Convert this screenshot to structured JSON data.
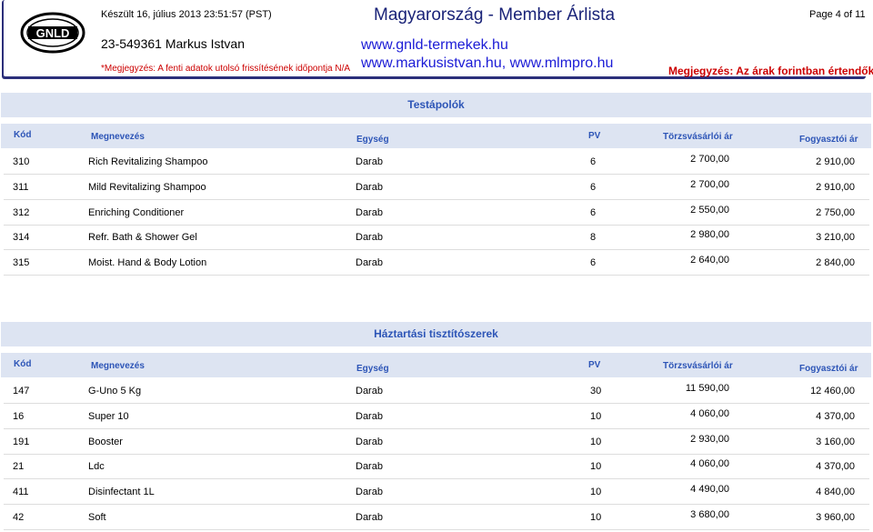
{
  "header": {
    "logo_text": "GNLD",
    "created": "Készült 16, július 2013 23:51:57 (PST)",
    "member_id": "23-549361",
    "member_name": "Markus Istvan",
    "note_left": "*Megjegyzés: A fenti adatok utolsó frissítésének időpontja N/A",
    "title": "Magyarország - Member Árlista",
    "site1": "www.gnld-termekek.hu",
    "site2": "www.markusistvan.hu, www.mlmpro.hu",
    "note_right": "Megjegyzés: Az árak forintban értendők",
    "page": "Page 4 of 11"
  },
  "columns": {
    "code": "Kód",
    "name": "Megnevezés",
    "unit": "Egység",
    "pv": "PV",
    "member_price": "Törzsvásárlói ár",
    "consumer_price": "Fogyasztói ár"
  },
  "sections": [
    {
      "title": "Testápolók",
      "rows": [
        {
          "code": "310",
          "name": "Rich Revitalizing Shampoo",
          "unit": "Darab",
          "pv": "6",
          "member_price": "2 700,00",
          "consumer_price": "2 910,00"
        },
        {
          "code": "311",
          "name": "Mild Revitalizing Shampoo",
          "unit": "Darab",
          "pv": "6",
          "member_price": "2 700,00",
          "consumer_price": "2 910,00"
        },
        {
          "code": "312",
          "name": "Enriching Conditioner",
          "unit": "Darab",
          "pv": "6",
          "member_price": "2 550,00",
          "consumer_price": "2 750,00"
        },
        {
          "code": "314",
          "name": "Refr. Bath & Shower Gel",
          "unit": "Darab",
          "pv": "8",
          "member_price": "2 980,00",
          "consumer_price": "3 210,00"
        },
        {
          "code": "315",
          "name": "Moist. Hand & Body Lotion",
          "unit": "Darab",
          "pv": "6",
          "member_price": "2 640,00",
          "consumer_price": "2 840,00"
        }
      ]
    },
    {
      "title": "Háztartási tisztítószerek",
      "rows": [
        {
          "code": "147",
          "name": "G-Uno 5 Kg",
          "unit": "Darab",
          "pv": "30",
          "member_price": "11 590,00",
          "consumer_price": "12 460,00"
        },
        {
          "code": "16",
          "name": "Super 10",
          "unit": "Darab",
          "pv": "10",
          "member_price": "4 060,00",
          "consumer_price": "4 370,00"
        },
        {
          "code": "191",
          "name": "Booster",
          "unit": "Darab",
          "pv": "10",
          "member_price": "2 930,00",
          "consumer_price": "3 160,00"
        },
        {
          "code": "21",
          "name": "Ldc",
          "unit": "Darab",
          "pv": "10",
          "member_price": "4 060,00",
          "consumer_price": "4 370,00"
        },
        {
          "code": "411",
          "name": "Disinfectant 1L",
          "unit": "Darab",
          "pv": "10",
          "member_price": "4 490,00",
          "consumer_price": "4 840,00"
        },
        {
          "code": "42",
          "name": "Soft",
          "unit": "Darab",
          "pv": "10",
          "member_price": "3 680,00",
          "consumer_price": "3 960,00"
        }
      ]
    }
  ]
}
